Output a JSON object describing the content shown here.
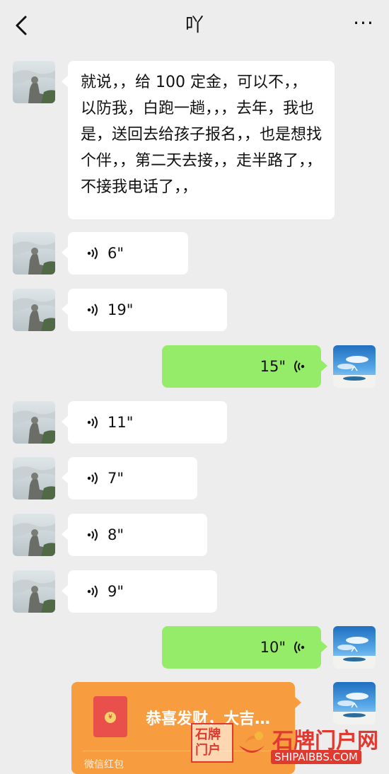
{
  "header": {
    "title": "吖",
    "back_icon": "chevron-left-icon",
    "more_label": "···"
  },
  "messages": [
    {
      "side": "left",
      "type": "text",
      "text": "就说，，给 100 定金，可以不，，以防我，白跑一趟，，，去年，我也是，送回去给孩子报名，，也是想找个伴，，第二天去接，，走半路了，，不接我电话了，，"
    },
    {
      "side": "left",
      "type": "voice",
      "duration": "6\""
    },
    {
      "side": "left",
      "type": "voice",
      "duration": "19\""
    },
    {
      "side": "right",
      "type": "voice",
      "duration": "15\""
    },
    {
      "side": "left",
      "type": "voice",
      "duration": "11\""
    },
    {
      "side": "left",
      "type": "voice",
      "duration": "7\""
    },
    {
      "side": "left",
      "type": "voice",
      "duration": "8\""
    },
    {
      "side": "left",
      "type": "voice",
      "duration": "9\""
    },
    {
      "side": "right",
      "type": "voice",
      "duration": "10\""
    },
    {
      "side": "right",
      "type": "red_packet",
      "title": "恭喜发财，大吉…",
      "footer": "微信红包",
      "coin": "¥"
    }
  ],
  "watermark": {
    "box_text": "石牌门户",
    "text": "石牌门户网",
    "sub": "SHIPAIBBS.COM"
  },
  "colors": {
    "background": "#ededed",
    "bubble_left": "#ffffff",
    "bubble_right": "#95ec69",
    "red_packet": "#f79c3f"
  }
}
